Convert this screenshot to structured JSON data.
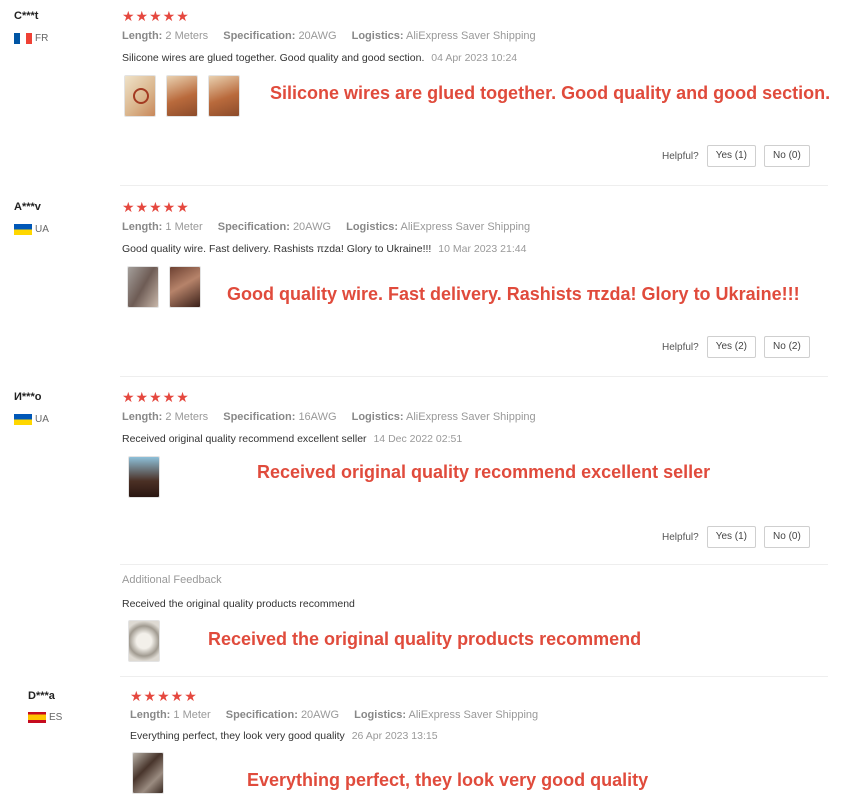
{
  "labels": {
    "length": "Length:",
    "specification": "Specification:",
    "logistics": "Logistics:",
    "helpful": "Helpful?"
  },
  "colors": {
    "stars": "#e5483f",
    "overlay": "#e04b3c"
  },
  "reviews": [
    {
      "user": "C***t",
      "country": "FR",
      "stars": "★★★★★",
      "length": "2 Meters",
      "specification": "20AWG",
      "logistics": "AliExpress Saver Shipping",
      "text": "Silicone wires are glued together. Good quality and good section.",
      "date": "04 Apr 2023 10:24",
      "overlay": "Silicone wires are glued together. Good quality and good section.",
      "yes": "Yes (1)",
      "no": "No (0)"
    },
    {
      "user": "A***v",
      "country": "UA",
      "stars": "★★★★★",
      "length": "1 Meter",
      "specification": "20AWG",
      "logistics": "AliExpress Saver Shipping",
      "text": "Good quality wire. Fast delivery. Rashists πzda! Glory to Ukraine!!!",
      "date": "10 Mar 2023 21:44",
      "overlay": "Good quality wire. Fast delivery. Rashists πzda! Glory to Ukraine!!!",
      "yes": "Yes (2)",
      "no": "No (2)"
    },
    {
      "user": "И***o",
      "country": "UA",
      "stars": "★★★★★",
      "length": "2 Meters",
      "specification": "16AWG",
      "logistics": "AliExpress Saver Shipping",
      "text": "Received original quality recommend excellent seller",
      "date": "14 Dec 2022 02:51",
      "overlay": "Received original quality recommend excellent seller",
      "yes": "Yes (1)",
      "no": "No (0)",
      "additional_title": "Additional Feedback",
      "additional_text": "Received the original quality products recommend",
      "additional_overlay": "Received the original quality products recommend"
    },
    {
      "user": "D***a",
      "country": "ES",
      "stars": "★★★★★",
      "length": "1 Meter",
      "specification": "20AWG",
      "logistics": "AliExpress Saver Shipping",
      "text": "Everything perfect, they look very good quality",
      "date": "26 Apr 2023 13:15",
      "overlay": "Everything perfect, they look very good quality"
    }
  ]
}
